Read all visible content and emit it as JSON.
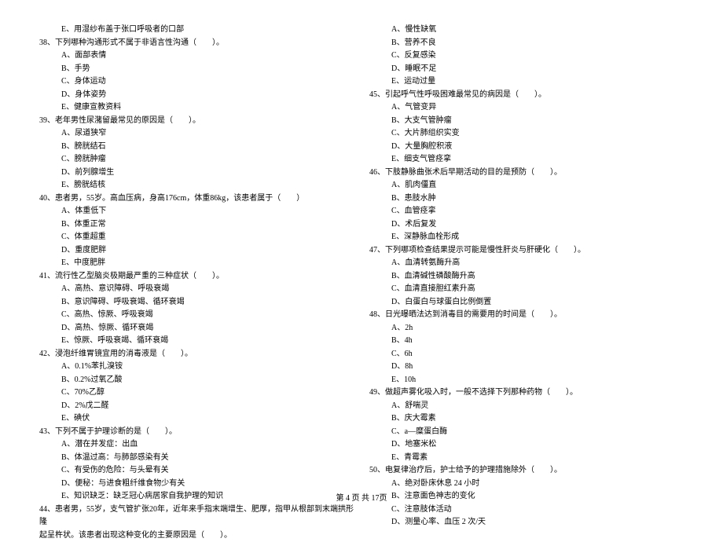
{
  "left_column": {
    "pre_option": "E、用湿纱布盖于张口呼吸者的口部",
    "q38": {
      "stem": "38、下列哪种沟通形式不属于非语言性沟通（　　）。",
      "a": "A、面部表情",
      "b": "B、手势",
      "c": "C、身体运动",
      "d": "D、身体姿势",
      "e": "E、健康宣教资料"
    },
    "q39": {
      "stem": "39、老年男性尿潴留最常见的原因是（　　）。",
      "a": "A、尿道狭窄",
      "b": "B、膀胱结石",
      "c": "C、膀胱肿瘤",
      "d": "D、前列腺增生",
      "e": "E、膀胱结核"
    },
    "q40": {
      "stem": "40、患者男，55岁。高血压病，身高176cm，体重86kg，该患者属于（　　）",
      "a": "A、体重低下",
      "b": "B、体重正常",
      "c": "C、体重超重",
      "d": "D、重度肥胖",
      "e": "E、中度肥胖"
    },
    "q41": {
      "stem": "41、流行性乙型脑炎极期最严重的三种症状（　　）。",
      "a": "A、高热、意识障碍、呼吸衰竭",
      "b": "B、意识障碍、呼吸衰竭、循环衰竭",
      "c": "C、高热、惊厥、呼吸衰竭",
      "d": "D、高热、惊厥、循环衰竭",
      "e": "E、惊厥、呼吸衰竭、循环衰竭"
    },
    "q42": {
      "stem": "42、浸泡纤维胃镜宜用的消毒液是（　　）。",
      "a": "A、0.1%苯扎溴铵",
      "b": "B、0.2%过氧乙酸",
      "c": "C、70%乙醇",
      "d": "D、2%戊二醛",
      "e": "E、碘伏"
    },
    "q43": {
      "stem": "43、下列不属于护理诊断的是（　　）。",
      "a": "A、潜在并发症：出血",
      "b": "B、体温过高：与肺部感染有关",
      "c": "C、有受伤的危险：与头晕有关",
      "d": "D、便秘：与进食粗纤维食物少有关",
      "e": "E、知识缺乏：缺乏冠心病居家自我护理的知识"
    },
    "q44": {
      "stem": "44、患者男，55岁，支气管扩张20年，近年来手指末端增生、肥厚，指甲从根部到末端拱形隆",
      "cont": "起呈杵状。该患者出现这种变化的主要原因是（　　）。"
    }
  },
  "right_column": {
    "q44_opts": {
      "a": "A、慢性缺氧",
      "b": "B、营养不良",
      "c": "C、反复感染",
      "d": "D、睡眠不足",
      "e": "E、运动过量"
    },
    "q45": {
      "stem": "45、引起呼气性呼吸困难最常见的病因是（　　）。",
      "a": "A、气管变异",
      "b": "B、大支气管肿瘤",
      "c": "C、大片肺组织实变",
      "d": "D、大量胸腔积液",
      "e": "E、细支气管痉挛"
    },
    "q46": {
      "stem": "46、下肢静脉曲张术后早期活动的目的是预防（　　）。",
      "a": "A、肌肉僵直",
      "b": "B、患肢水肿",
      "c": "C、血管痉挛",
      "d": "D、术后复发",
      "e": "E、深静脉血栓形成"
    },
    "q47": {
      "stem": "47、下列哪项检查结果提示可能是慢性肝炎与肝硬化（　　）。",
      "a": "A、血清转氨酶升高",
      "b": "B、血清碱性磷酸酶升高",
      "c": "C、血清直接胆红素升高",
      "d": "D、白蛋白与球蛋白比例倒置",
      "e": ""
    },
    "q48": {
      "stem": "48、日光曝晒法达到消毒目的需要用的时间是（　　）。",
      "a": "A、2h",
      "b": "B、4h",
      "c": "C、6h",
      "d": "D、8h",
      "e": "E、10h"
    },
    "q49": {
      "stem": "49、做超声雾化吸入时，一般不选择下列那种药物（　　）。",
      "a": "A、舒喘灵",
      "b": "B、庆大霉素",
      "c": "C、a—糜蛋白酶",
      "d": "D、地塞米松",
      "e": "E、青霉素"
    },
    "q50": {
      "stem": "50、电复律治疗后，护士给予的护理措施除外（　　）。",
      "a": "A、绝对卧床休息 24 小时",
      "b": "B、注意面色神志的变化",
      "c": "C、注意肢体活动",
      "d": "D、测量心率、血压 2 次/天"
    }
  },
  "footer": "第 4 页 共 17页"
}
